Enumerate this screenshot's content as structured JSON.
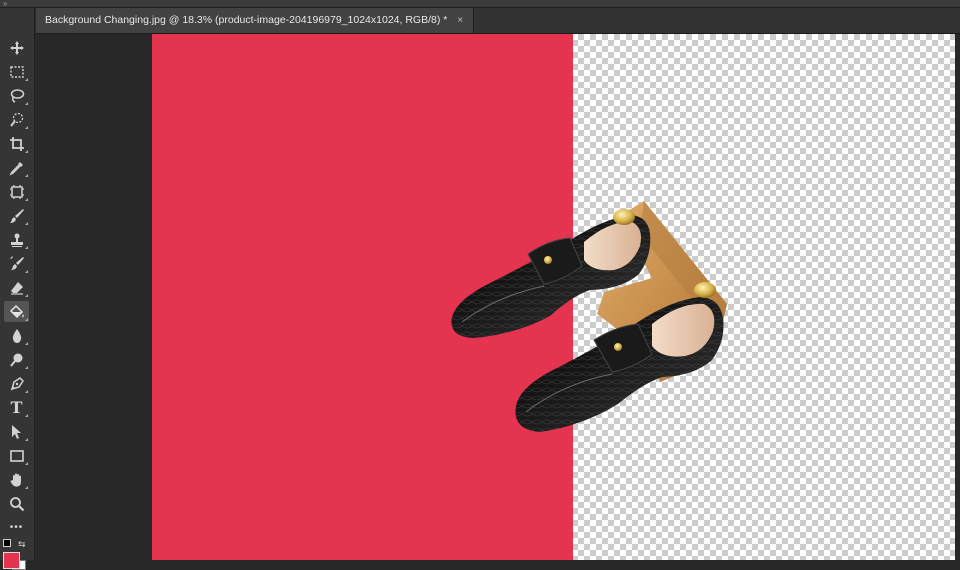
{
  "document": {
    "tab_title": "Background Changing.jpg @ 18.3% (product-image-204196979_1024x1024, RGB/8) *",
    "close_glyph": "×"
  },
  "colors": {
    "foreground": "#e2334f",
    "background": "#ffffff",
    "fill_color": "#e5344f"
  },
  "toolbar": {
    "tools": [
      {
        "name": "move-tool",
        "icon": "move-icon"
      },
      {
        "name": "marquee-tool",
        "icon": "rect-marquee-icon"
      },
      {
        "name": "lasso-tool",
        "icon": "lasso-icon"
      },
      {
        "name": "quick-selection-tool",
        "icon": "quick-select-icon"
      },
      {
        "name": "crop-tool",
        "icon": "crop-icon"
      },
      {
        "name": "eyedropper-tool",
        "icon": "eyedropper-icon"
      },
      {
        "name": "frame-tool",
        "icon": "frame-icon"
      },
      {
        "name": "brush-tool",
        "icon": "brush-icon"
      },
      {
        "name": "clone-stamp-tool",
        "icon": "stamp-icon"
      },
      {
        "name": "history-brush-tool",
        "icon": "history-brush-icon"
      },
      {
        "name": "eraser-tool",
        "icon": "eraser-icon"
      },
      {
        "name": "paint-bucket-tool",
        "icon": "paint-bucket-icon",
        "active": true
      },
      {
        "name": "blur-tool",
        "icon": "blur-icon"
      },
      {
        "name": "dodge-tool",
        "icon": "dodge-icon"
      },
      {
        "name": "pen-tool",
        "icon": "pen-icon"
      },
      {
        "name": "type-tool",
        "icon": "type-icon",
        "glyph": "T"
      },
      {
        "name": "path-selection-tool",
        "icon": "path-select-icon"
      },
      {
        "name": "rectangle-tool",
        "icon": "rectangle-icon"
      },
      {
        "name": "hand-tool",
        "icon": "hand-icon"
      },
      {
        "name": "zoom-tool",
        "icon": "zoom-icon"
      },
      {
        "name": "edit-toolbar",
        "icon": "more-icon",
        "glyph": "•••"
      }
    ]
  }
}
